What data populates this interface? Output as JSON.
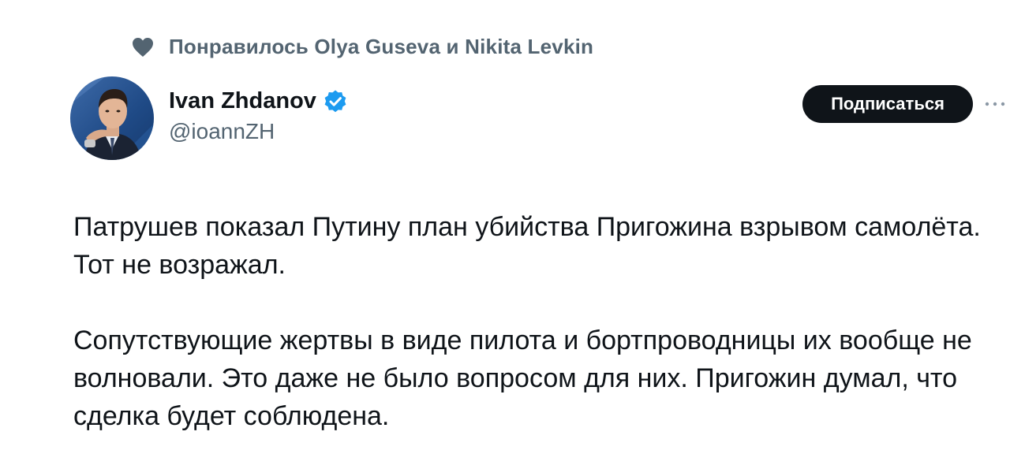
{
  "social_context": {
    "icon": "heart-icon",
    "text": "Понравилось Olya Guseva и Nikita Levkin"
  },
  "author": {
    "name": "Ivan Zhdanov",
    "handle": "@ioannZH",
    "verified": true,
    "verified_color": "#1d9bf0",
    "avatar_icon": "avatar-photo"
  },
  "follow_button": {
    "label": "Подписаться"
  },
  "more_menu": {
    "icon": "more-dots-icon",
    "label": "···"
  },
  "tweet": {
    "paragraphs": [
      "Патрушев показал Путину план убийства Пригожина взрывом самолёта. Тот не возражал.",
      "Сопутствующие жертвы в виде пилота и бортпроводницы их вообще не волновали. Это даже не было вопросом для них. Пригожин думал, что сделка будет соблюдена."
    ]
  },
  "colors": {
    "text_primary": "#0f1419",
    "text_secondary": "#536471",
    "button_bg": "#0f1419",
    "button_text": "#ffffff",
    "background": "#ffffff"
  }
}
